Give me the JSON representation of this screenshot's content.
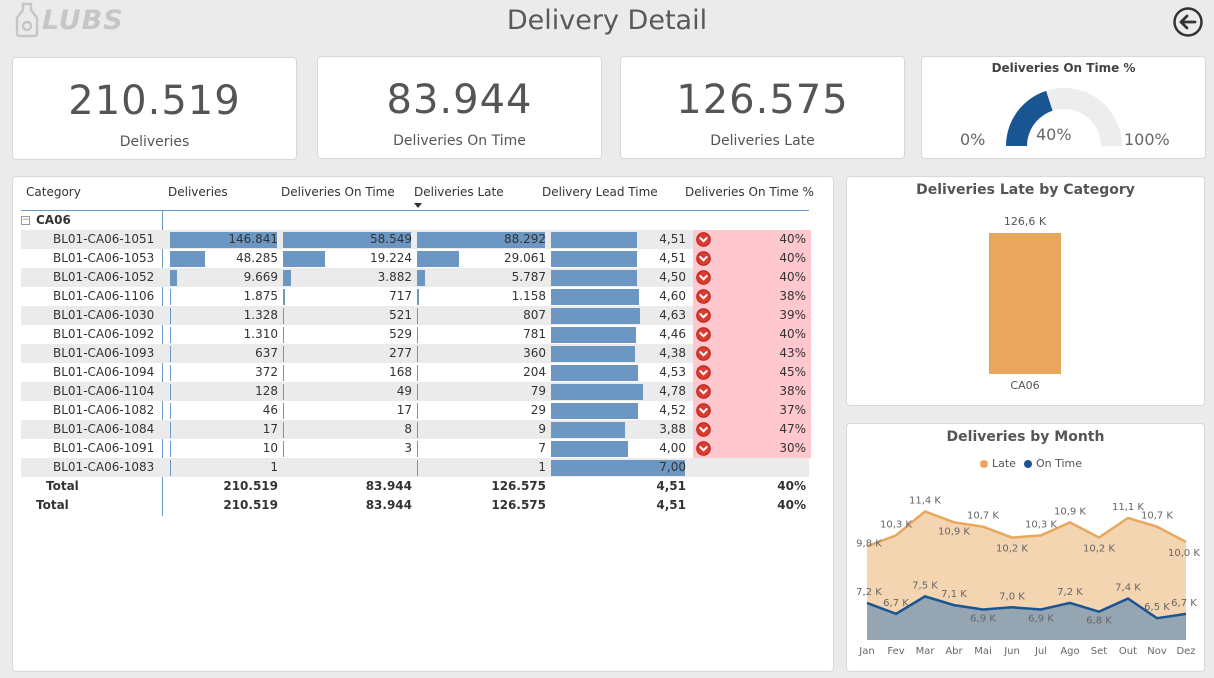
{
  "header": {
    "logo_text": "LUBS",
    "title": "Delivery Detail"
  },
  "kpis": [
    {
      "value": "210.519",
      "label": "Deliveries"
    },
    {
      "value": "83.944",
      "label": "Deliveries On Time"
    },
    {
      "value": "126.575",
      "label": "Deliveries Late"
    }
  ],
  "gauge": {
    "title": "Deliveries On Time %",
    "value_label": "40%",
    "min_label": "0%",
    "max_label": "100%",
    "fraction": 0.4,
    "fill_color": "#1a5593",
    "track_color": "#ededed"
  },
  "table": {
    "columns": [
      "Category",
      "Deliveries",
      "Deliveries On Time",
      "Deliveries Late",
      "Delivery Lead Time",
      "Deliveries On Time %"
    ],
    "group_label": "CA06",
    "rows": [
      {
        "name": "BL01-CA06-1051",
        "deliveries": "146.841",
        "on_time": "58.549",
        "late": "88.292",
        "lead": "4,51",
        "pct": "40%",
        "d": 146841,
        "o": 58549,
        "l": 88292,
        "lt": 4.51
      },
      {
        "name": "BL01-CA06-1053",
        "deliveries": "48.285",
        "on_time": "19.224",
        "late": "29.061",
        "lead": "4,51",
        "pct": "40%",
        "d": 48285,
        "o": 19224,
        "l": 29061,
        "lt": 4.51
      },
      {
        "name": "BL01-CA06-1052",
        "deliveries": "9.669",
        "on_time": "3.882",
        "late": "5.787",
        "lead": "4,50",
        "pct": "40%",
        "d": 9669,
        "o": 3882,
        "l": 5787,
        "lt": 4.5
      },
      {
        "name": "BL01-CA06-1106",
        "deliveries": "1.875",
        "on_time": "717",
        "late": "1.158",
        "lead": "4,60",
        "pct": "38%",
        "d": 1875,
        "o": 717,
        "l": 1158,
        "lt": 4.6
      },
      {
        "name": "BL01-CA06-1030",
        "deliveries": "1.328",
        "on_time": "521",
        "late": "807",
        "lead": "4,63",
        "pct": "39%",
        "d": 1328,
        "o": 521,
        "l": 807,
        "lt": 4.63
      },
      {
        "name": "BL01-CA06-1092",
        "deliveries": "1.310",
        "on_time": "529",
        "late": "781",
        "lead": "4,46",
        "pct": "40%",
        "d": 1310,
        "o": 529,
        "l": 781,
        "lt": 4.46
      },
      {
        "name": "BL01-CA06-1093",
        "deliveries": "637",
        "on_time": "277",
        "late": "360",
        "lead": "4,38",
        "pct": "43%",
        "d": 637,
        "o": 277,
        "l": 360,
        "lt": 4.38
      },
      {
        "name": "BL01-CA06-1094",
        "deliveries": "372",
        "on_time": "168",
        "late": "204",
        "lead": "4,53",
        "pct": "45%",
        "d": 372,
        "o": 168,
        "l": 204,
        "lt": 4.53
      },
      {
        "name": "BL01-CA06-1104",
        "deliveries": "128",
        "on_time": "49",
        "late": "79",
        "lead": "4,78",
        "pct": "38%",
        "d": 128,
        "o": 49,
        "l": 79,
        "lt": 4.78
      },
      {
        "name": "BL01-CA06-1082",
        "deliveries": "46",
        "on_time": "17",
        "late": "29",
        "lead": "4,52",
        "pct": "37%",
        "d": 46,
        "o": 17,
        "l": 29,
        "lt": 4.52
      },
      {
        "name": "BL01-CA06-1084",
        "deliveries": "17",
        "on_time": "8",
        "late": "9",
        "lead": "3,88",
        "pct": "47%",
        "d": 17,
        "o": 8,
        "l": 9,
        "lt": 3.88
      },
      {
        "name": "BL01-CA06-1091",
        "deliveries": "10",
        "on_time": "3",
        "late": "7",
        "lead": "4,00",
        "pct": "30%",
        "d": 10,
        "o": 3,
        "l": 7,
        "lt": 4.0
      },
      {
        "name": "BL01-CA06-1083",
        "deliveries": "1",
        "on_time": "",
        "late": "1",
        "lead": "7,00",
        "pct": "",
        "d": 1,
        "o": 0,
        "l": 1,
        "lt": 7.0
      }
    ],
    "subtotal": {
      "name": "Total",
      "deliveries": "210.519",
      "on_time": "83.944",
      "late": "126.575",
      "lead": "4,51",
      "pct": "40%"
    },
    "total": {
      "name": "Total",
      "deliveries": "210.519",
      "on_time": "83.944",
      "late": "126.575",
      "lead": "4,51",
      "pct": "40%"
    },
    "bar_color": "#6b97c2",
    "alert_bg": "#ffc7ce",
    "alert_icon": "red-chevron-down-circle-icon"
  },
  "chart_data": [
    {
      "type": "bar",
      "title": "Deliveries Late by Category",
      "categories": [
        "CA06"
      ],
      "values": [
        126575
      ],
      "data_labels": [
        "126,6 K"
      ],
      "color": "#e8a75c",
      "ylim": [
        0,
        126575
      ]
    },
    {
      "type": "area",
      "title": "Deliveries by Month",
      "categories": [
        "Jan",
        "Fev",
        "Mar",
        "Abr",
        "Mai",
        "Jun",
        "Jul",
        "Ago",
        "Set",
        "Out",
        "Nov",
        "Dez"
      ],
      "series": [
        {
          "name": "Late",
          "color": "#e8a75c",
          "values": [
            9.8,
            10.3,
            11.4,
            10.9,
            10.7,
            10.2,
            10.3,
            10.9,
            10.2,
            11.1,
            10.7,
            10.0
          ],
          "labels": [
            "9,8 K",
            "10,3 K",
            "11,4 K",
            "10,9 K",
            "10,7 K",
            "10,2 K",
            "10,3 K",
            "10,9 K",
            "10,2 K",
            "11,1 K",
            "10,7 K",
            "10,0 K"
          ]
        },
        {
          "name": "On Time",
          "color": "#1a5593",
          "values": [
            7.2,
            6.7,
            7.5,
            7.1,
            6.9,
            7.0,
            6.9,
            7.2,
            6.8,
            7.4,
            6.5,
            6.7
          ],
          "labels": [
            "7,2 K",
            "6,7 K",
            "7,5 K",
            "7,1 K",
            "6,9 K",
            "7,0 K",
            "6,9 K",
            "7,2 K",
            "6,8 K",
            "7,4 K",
            "6,5 K",
            "6,7 K"
          ]
        }
      ],
      "legend_position": "top-center"
    }
  ]
}
